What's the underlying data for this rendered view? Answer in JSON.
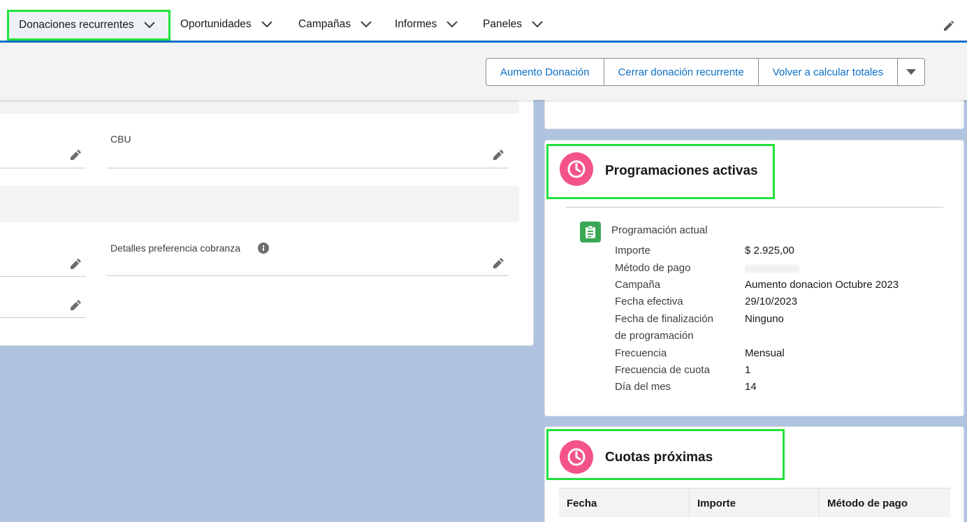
{
  "nav": {
    "items": [
      {
        "label": "Donaciones recurrentes"
      },
      {
        "label": "Oportunidades"
      },
      {
        "label": "Campañas"
      },
      {
        "label": "Informes"
      },
      {
        "label": "Paneles"
      }
    ]
  },
  "actions": {
    "buttons": [
      {
        "label": "Aumento Donación"
      },
      {
        "label": "Cerrar donación recurrente"
      },
      {
        "label": "Volver a calcular totales"
      }
    ]
  },
  "detail": {
    "cbu_label": "CBU",
    "preference_label": "Detalles preferencia cobranza"
  },
  "active_schedules": {
    "title": "Programaciones activas",
    "current_label": "Programación actual",
    "fields": [
      {
        "label": "Importe",
        "value": "$ 2.925,00"
      },
      {
        "label": "Método de pago",
        "value": ""
      },
      {
        "label": "Campaña",
        "value": "Aumento donacion Octubre 2023"
      },
      {
        "label": "Fecha efectiva",
        "value": "29/10/2023"
      },
      {
        "label": "Fecha de finalización",
        "label2": "de programación",
        "value": "Ninguno"
      },
      {
        "label": "Frecuencia",
        "value": "Mensual"
      },
      {
        "label": "Frecuencia de cuota",
        "value": "1"
      },
      {
        "label": "Día del mes",
        "value": "14"
      }
    ]
  },
  "upcoming": {
    "title": "Cuotas próximas",
    "columns": [
      "Fecha",
      "Importe",
      "Método de pago"
    ]
  },
  "colors": {
    "brand_blue": "#0b6fc7",
    "highlight_green": "#21e23c",
    "icon_pink": "#f4538a",
    "icon_green": "#3ba755",
    "page_bg": "#b0c4df"
  }
}
